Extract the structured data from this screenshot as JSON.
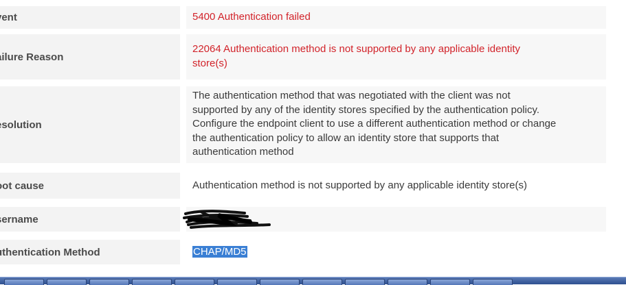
{
  "rows": [
    {
      "label": "vent",
      "value": "5400 Authentication failed"
    },
    {
      "label": "ailure Reason",
      "value_lines": [
        "22064 Authentication method is not supported by any applicable identity",
        "store(s)"
      ]
    },
    {
      "label": "esolution",
      "value_lines": [
        "The authentication method that was negotiated with the client was not",
        "supported by any of the identity stores specified by the authentication policy.",
        "Configure the endpoint client to use a different authentication method or change",
        "the authentication policy to allow an identity store that supports that",
        "authentication method"
      ]
    },
    {
      "label": "oot cause",
      "value": "Authentication method is not supported by any applicable identity store(s)"
    },
    {
      "label": "sername",
      "value": ""
    },
    {
      "label": "uthentication Method",
      "value": "CHAP/MD5"
    }
  ],
  "colors": {
    "error": "#d2232a",
    "selection": "#3a7fd4"
  },
  "icons": [
    "redacted-scribble"
  ]
}
